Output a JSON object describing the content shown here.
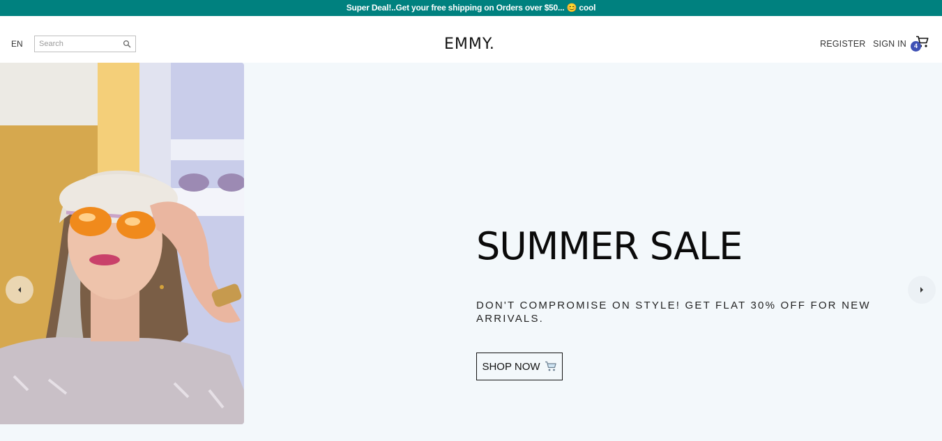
{
  "announcement": {
    "text": "Super Deal!..Get your free shipping on Orders over $50... 😊 cool"
  },
  "header": {
    "language": "EN",
    "search_placeholder": "Search",
    "logo": "EMMY.",
    "register_label": "REGISTER",
    "signin_label": "SIGN IN",
    "cart_count": "4"
  },
  "hero": {
    "title": "SUMMER SALE",
    "subtitle": "DON'T COMPROMISE ON STYLE! GET FLAT 30% OFF FOR NEW ARRIVALS.",
    "cta_label": "SHOP NOW"
  },
  "icons": {
    "search": "search-icon",
    "cart": "cart-icon",
    "cta": "cart-icon",
    "prev": "arrow-left-icon",
    "next": "arrow-right-icon"
  },
  "colors": {
    "announcement_bg": "#00817f",
    "hero_bg": "#f3f8fb",
    "badge": "#3f51b5"
  }
}
